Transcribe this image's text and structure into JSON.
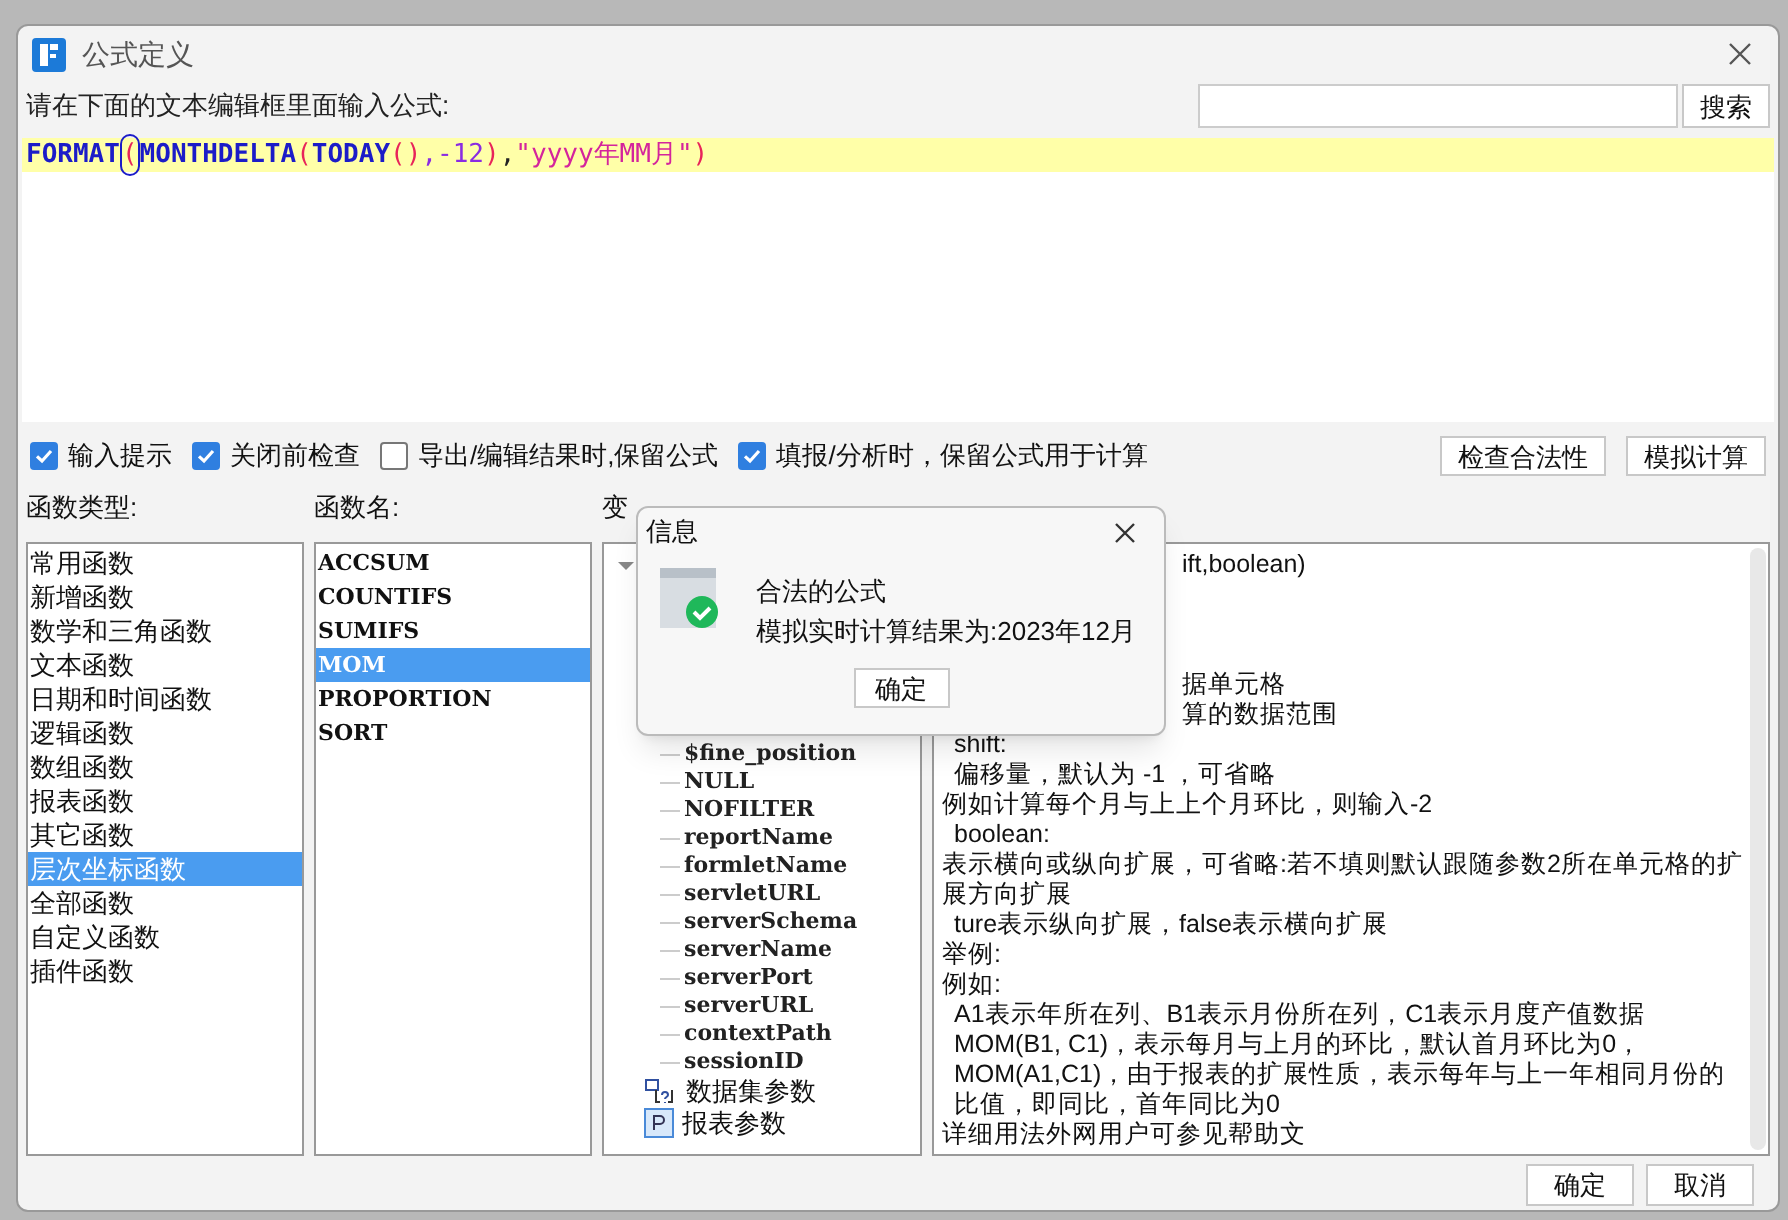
{
  "window": {
    "title": "公式定义"
  },
  "prompt": "请在下面的文本编辑框里面输入公式:",
  "search": {
    "button": "搜索"
  },
  "formula": [
    {
      "text": "FORMAT",
      "kind": "func",
      "matched": false
    },
    {
      "text": "(",
      "kind": "paren",
      "matched": true
    },
    {
      "text": "MONTHDELTA",
      "kind": "func",
      "matched": false
    },
    {
      "text": "(",
      "kind": "paren",
      "matched": false
    },
    {
      "text": "TODAY",
      "kind": "func",
      "matched": false
    },
    {
      "text": "()",
      "kind": "paren",
      "matched": false
    },
    {
      "text": ",-12",
      "kind": "number",
      "matched": false
    },
    {
      "text": ")",
      "kind": "paren",
      "matched": false
    },
    {
      "text": ",",
      "kind": "punct",
      "matched": false
    },
    {
      "text": "\"yyyy年MM月\"",
      "kind": "string",
      "matched": false
    },
    {
      "text": ")",
      "kind": "paren",
      "matched": false
    }
  ],
  "options": [
    {
      "label": "输入提示",
      "checked": true
    },
    {
      "label": "关闭前检查",
      "checked": true
    },
    {
      "label": "导出/编辑结果时,保留公式",
      "checked": false
    },
    {
      "label": "填报/分析时，保留公式用于计算",
      "checked": true
    }
  ],
  "action_buttons": [
    "检查合法性",
    "模拟计算"
  ],
  "category_label": "函数类型:",
  "categories": [
    {
      "label": "常用函数",
      "selected": false
    },
    {
      "label": "新增函数",
      "selected": false
    },
    {
      "label": "数学和三角函数",
      "selected": false
    },
    {
      "label": "文本函数",
      "selected": false
    },
    {
      "label": "日期和时间函数",
      "selected": false
    },
    {
      "label": "逻辑函数",
      "selected": false
    },
    {
      "label": "数组函数",
      "selected": false
    },
    {
      "label": "报表函数",
      "selected": false
    },
    {
      "label": "其它函数",
      "selected": false
    },
    {
      "label": "层次坐标函数",
      "selected": true
    },
    {
      "label": "全部函数",
      "selected": false
    },
    {
      "label": "自定义函数",
      "selected": false
    },
    {
      "label": "插件函数",
      "selected": false
    }
  ],
  "function_label": "函数名:",
  "functions": [
    {
      "label": "ACCSUM",
      "selected": false
    },
    {
      "label": "COUNTIFS",
      "selected": false
    },
    {
      "label": "SUMIFS",
      "selected": false
    },
    {
      "label": "MOM",
      "selected": true
    },
    {
      "label": "PROPORTION",
      "selected": false
    },
    {
      "label": "SORT",
      "selected": false
    }
  ],
  "variable_label": "变",
  "variables": [
    {
      "kind": "group",
      "expanded": true,
      "children": [
        {
          "label": "$fine_position"
        },
        {
          "label": "NULL"
        },
        {
          "label": "NOFILTER"
        },
        {
          "label": "reportName"
        },
        {
          "label": "formletName"
        },
        {
          "label": "servletURL"
        },
        {
          "label": "serverSchema"
        },
        {
          "label": "serverName"
        },
        {
          "label": "serverPort"
        },
        {
          "label": "serverURL"
        },
        {
          "label": "contextPath"
        },
        {
          "label": "sessionID"
        }
      ]
    },
    {
      "kind": "dataset",
      "label": "数据集参数"
    },
    {
      "kind": "param",
      "label": "报表参数"
    }
  ],
  "description": [
    {
      "kind": "clipped",
      "text": "ift,boolean)"
    },
    {
      "kind": "clipped_gap",
      "text": "据单元格"
    },
    {
      "kind": "clipped",
      "text": "算的数据范围"
    },
    {
      "kind": "indent",
      "text": "shift:"
    },
    {
      "kind": "indent",
      "text": "偏移量，默认为 -1 ，可省略"
    },
    {
      "kind": "text",
      "text": "例如计算每个月与上上个月环比，则输入-2"
    },
    {
      "kind": "indent",
      "text": "boolean:"
    },
    {
      "kind": "text",
      "text": "表示横向或纵向扩展，可省略:若不填则默认跟随参数2所在单元格的扩展方向扩展"
    },
    {
      "kind": "indent",
      "text": "ture表示纵向扩展，false表示横向扩展"
    },
    {
      "kind": "text",
      "text": "举例:"
    },
    {
      "kind": "text",
      "text": "例如:"
    },
    {
      "kind": "indent",
      "text": "A1表示年所在列、B1表示月份所在列，C1表示月度产值数据"
    },
    {
      "kind": "indent",
      "text": "MOM(B1, C1)，表示每月与上月的环比，默认首月环比为0，"
    },
    {
      "kind": "indent",
      "text": "MOM(A1,C1)，由于报表的扩展性质，表示每年与上一年相同月份的比值，即同比，首年同比为0"
    },
    {
      "kind": "text",
      "text": "详细用法外网用户可参见帮助文"
    }
  ],
  "footer_buttons": [
    "确定",
    "取消"
  ],
  "popup": {
    "title": "信息",
    "lines": [
      "合法的公式",
      "模拟实时计算结果为:2023年12月"
    ],
    "button": "确定"
  }
}
